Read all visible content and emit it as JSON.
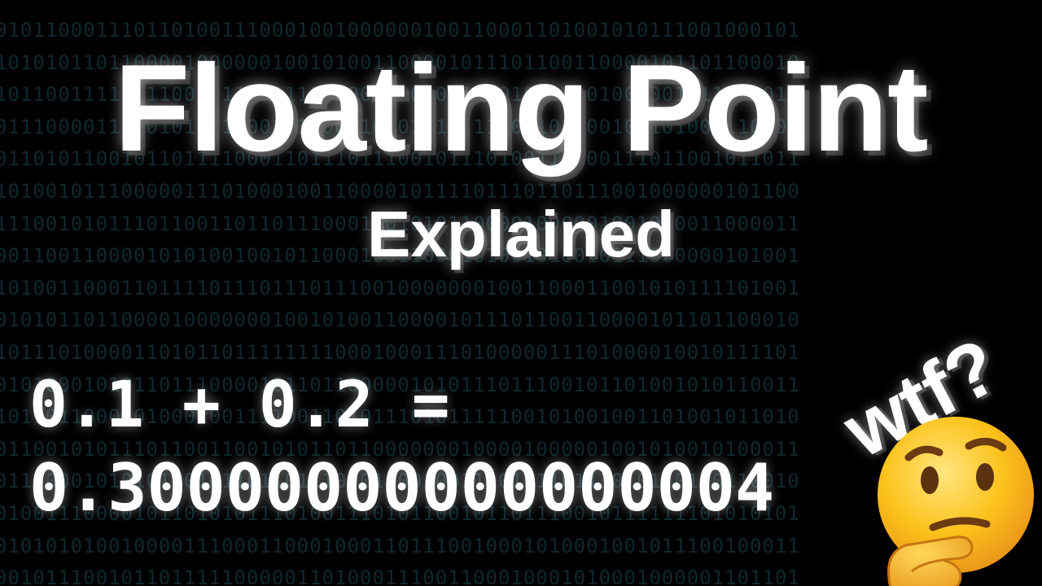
{
  "background": {
    "color": "#000000",
    "binary_color": "#1c4a55",
    "binary_rows": [
      "0101100011101101001110001001000000100110001101001010111001000101",
      "1010101101100001000000100101001100001011101100110000101101100010",
      "1011001111001100011110111001001100000101010001001000001111000011",
      "0111000011000101101000101100110101110111001101000101101000110000",
      "0110101100101101111000110111011100101110100110100111011001011011",
      "1010010111000001110100010011000010111101110110111001000000101100",
      "1110010101110110011011011100011010101100001000001001010011000011",
      "0011001100001010100100101100010011000101001010010111000000101001",
      "1010011000110111101110111011100100000001001100011001010111101001",
      "0101011011000010000000100101001100001011101100110000101101100010",
      "1011101000011010110111111110001000111010000011101000010010111101",
      "0101000101011011100001011011000001010111011100101101001010110011",
      "1011011000101000100111100110101110101111100101001001101001011010",
      "0110010101110110011001010110110000000100001000001001010010100011",
      "0111000101010100101101101110001100100110010110111010110100110010",
      "0100111000010110101011101001110101100101101110010111111101010101",
      "0101010100100001110001100010001101110010001010001001011100100011",
      "0010111001011011111000001101000111001100010001010001000001101101"
    ]
  },
  "title": "Floating Point",
  "subtitle": "Explained",
  "equation": {
    "line1": "0.1 + 0.2 =",
    "line2": "0.30000000000000004"
  },
  "reaction": {
    "text": "wtf?",
    "emoji_icon": "thinking-face-icon"
  }
}
